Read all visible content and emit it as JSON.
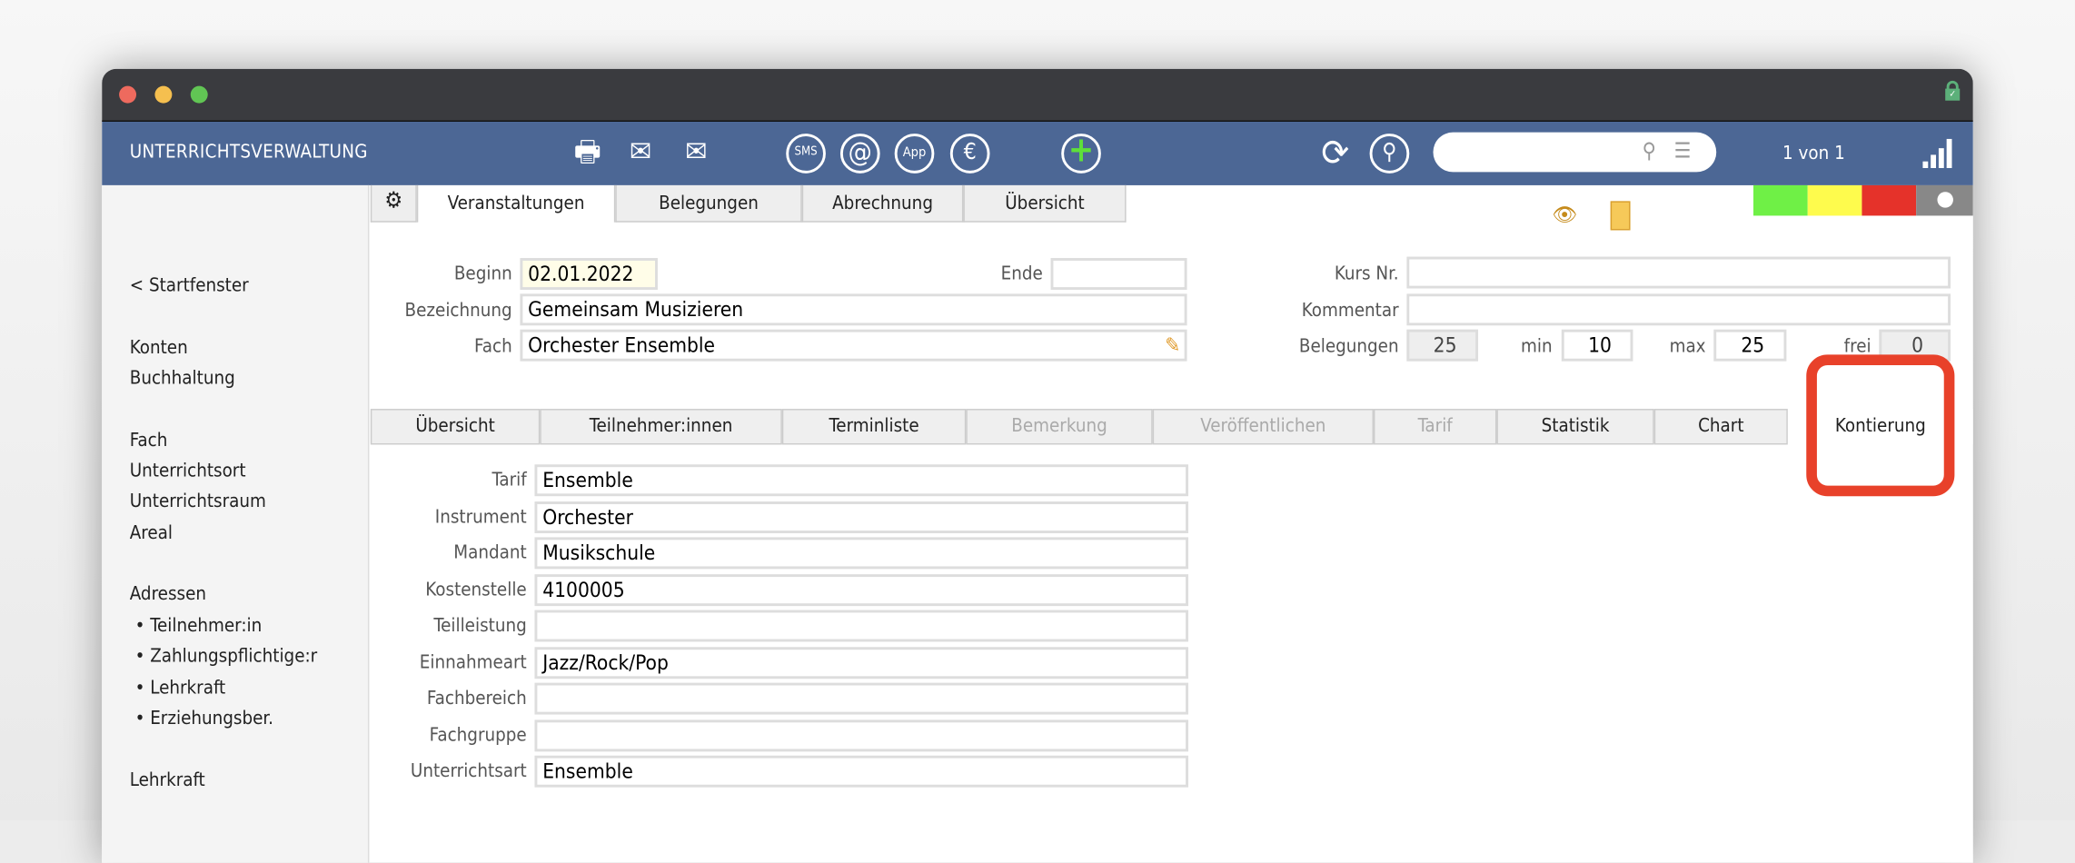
{
  "header": {
    "title": "UNTERRICHTSVERWALTUNG",
    "record_counter": "1 von 1",
    "search_value": "",
    "toolbar_icons": [
      "printer-icon",
      "mail-icon",
      "mail-batch-icon",
      "sms-icon",
      "at-icon",
      "app-icon",
      "euro-icon",
      "plus-icon",
      "refresh-icon",
      "search-icon"
    ],
    "sms": "SMS",
    "at": "@",
    "app": "App",
    "euro": "€",
    "plus": "+"
  },
  "sidebar": {
    "back": "< Startfenster",
    "items": [
      "Konten",
      "Buchhaltung",
      "Fach",
      "Unterrichtsort",
      "Unterrichtsraum",
      "Areal",
      "Adressen",
      "• Teilnehmer:in",
      "• Zahlungspflichtige:r",
      "• Lehrkraft",
      "• Erziehungsber.",
      "Lehrkraft"
    ]
  },
  "top_tabs": [
    "Veranstaltungen",
    "Belegungen",
    "Abrechnung",
    "Übersicht"
  ],
  "status_colors": [
    "#6ff046",
    "#fefb4d",
    "#e5322a",
    "#888888"
  ],
  "form": {
    "beginn_label": "Beginn",
    "beginn": "02.01.2022",
    "ende_label": "Ende",
    "ende": "",
    "bezeichnung_label": "Bezeichnung",
    "bezeichnung": "Gemeinsam Musizieren",
    "fach_label": "Fach",
    "fach": "Orchester Ensemble",
    "kursnr_label": "Kurs Nr.",
    "kursnr": "",
    "kommentar_label": "Kommentar",
    "kommentar": "",
    "belegungen_label": "Belegungen",
    "belegungen": "25",
    "min_label": "min",
    "min": "10",
    "max_label": "max",
    "max": "25",
    "frei_label": "frei",
    "frei": "0"
  },
  "sub_tabs": [
    {
      "label": "Übersicht"
    },
    {
      "label": "Teilnehmer:innen"
    },
    {
      "label": "Terminliste"
    },
    {
      "label": "Bemerkung",
      "disabled": true
    },
    {
      "label": "Veröffentlichen",
      "disabled": true
    },
    {
      "label": "Tarif",
      "disabled": true
    },
    {
      "label": "Statistik"
    },
    {
      "label": "Chart"
    },
    {
      "label": "Kontierung",
      "active": true
    }
  ],
  "kontierung": [
    {
      "label": "Tarif",
      "value": "Ensemble"
    },
    {
      "label": "Instrument",
      "value": "Orchester"
    },
    {
      "label": "Mandant",
      "value": "Musikschule"
    },
    {
      "label": "Kostenstelle",
      "value": "4100005"
    },
    {
      "label": "Teilleistung",
      "value": ""
    },
    {
      "label": "Einnahmeart",
      "value": "Jazz/Rock/Pop"
    },
    {
      "label": "Fachbereich",
      "value": ""
    },
    {
      "label": "Fachgruppe",
      "value": ""
    },
    {
      "label": "Unterrichtsart",
      "value": "Ensemble"
    }
  ],
  "highlight_color": "#e8412a"
}
